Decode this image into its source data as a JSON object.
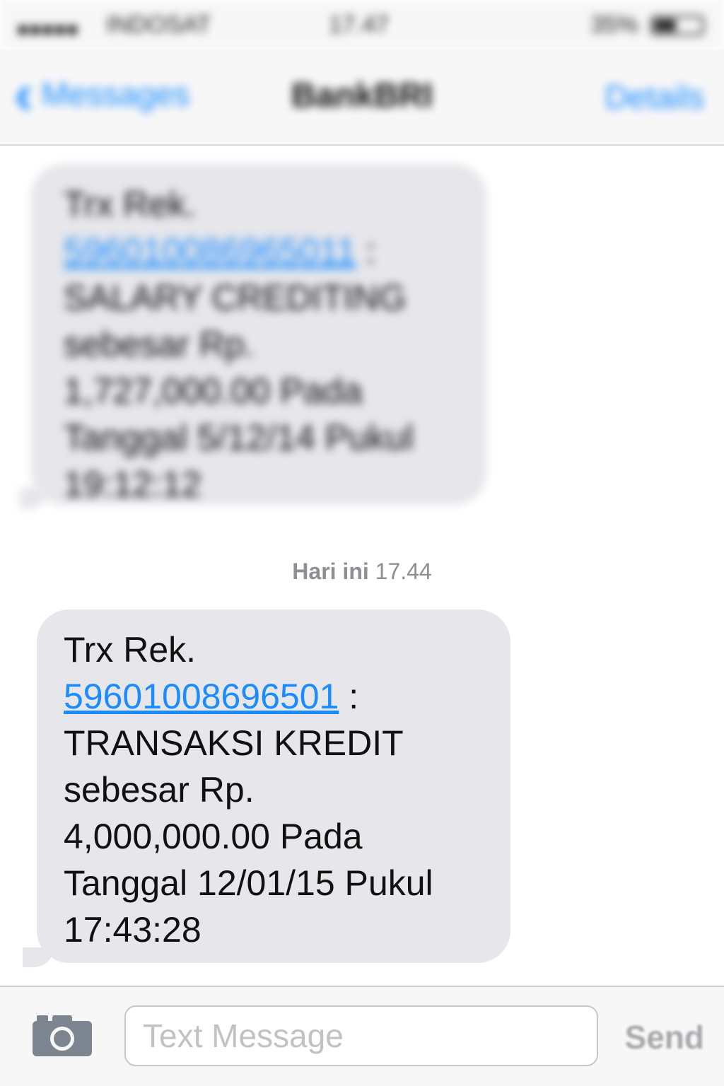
{
  "status_bar": {
    "signal": "●●●●●",
    "carrier": "INDOSAT",
    "time": "17.47",
    "battery_pct": "35%"
  },
  "nav": {
    "back_label": "Messages",
    "title": "BankBRI",
    "details_label": "Details"
  },
  "previous_message": {
    "lines": [
      "Trx Rek.",
      "596010086965011",
      "SALARY CREDITING",
      "sebesar Rp.",
      "1,727,000.00 Pada",
      "Tanggal 5/12/14 Pukul",
      "19:12:12"
    ],
    "link_separator": ":"
  },
  "timestamp": {
    "day": "Hari ini",
    "time": "17.44"
  },
  "latest_message": {
    "line1": "Trx Rek.",
    "account": "59601008696501",
    "separator": ":",
    "line3": "TRANSAKSI KREDIT",
    "line4": "sebesar Rp.",
    "line5": "4,000,000.00 Pada",
    "line6": "Tanggal 12/01/15 Pukul",
    "line7": "17:43:28"
  },
  "composer": {
    "placeholder": "Text Message",
    "send_label": "Send"
  },
  "colors": {
    "accent": "#1a8cff",
    "bubble": "#e6e6eb",
    "bar_bg": "#f7f7f8"
  },
  "icons": {
    "camera": "camera-icon",
    "back": "chevron-left-icon",
    "battery": "battery-icon"
  }
}
